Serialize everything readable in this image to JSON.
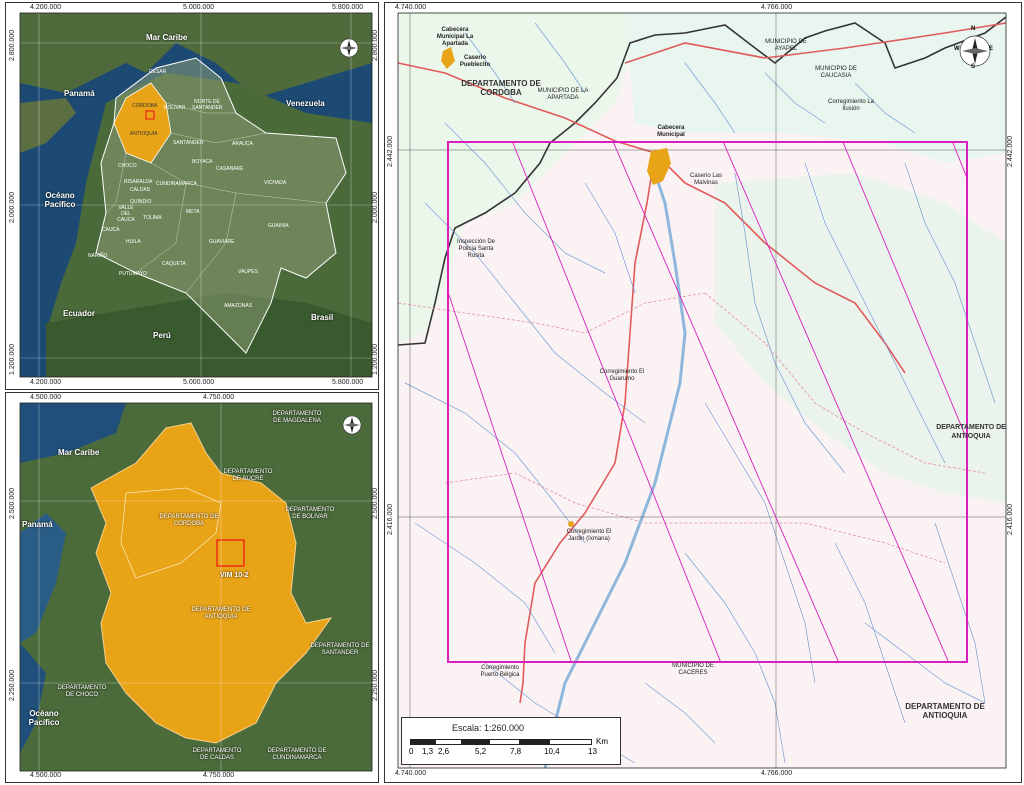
{
  "panel_tl": {
    "coords_top": [
      "4.200.000",
      "5.000.000",
      "5.800.000"
    ],
    "coords_bottom": [
      "4.200.000",
      "5.000.000",
      "5.800.000"
    ],
    "coords_left": [
      "2.800.000",
      "2.000.000",
      "1.200.000"
    ],
    "coords_right": [
      "2.800.000",
      "2.000.000",
      "1.200.000"
    ],
    "oceans": [
      "Mar Caribe",
      "Océano Pacífico"
    ],
    "countries": [
      "Panamá",
      "Venezuela",
      "Ecuador",
      "Perú",
      "Brasil"
    ],
    "departments": [
      "CESAR",
      "CORDOBA",
      "BOLIVAR",
      "NORTE DE SANTANDER",
      "ANTIOQUIA",
      "SANTANDER",
      "ARAUCA",
      "CHOCO",
      "BOYACA",
      "CASANARE",
      "RISARALDA",
      "CUNDINAMARCA",
      "VICHADA",
      "CALDAS",
      "QUINDIO",
      "META",
      "VALLE DEL CAUCA",
      "TOLIMA",
      "HUILA",
      "GUAINIA",
      "CAUCA",
      "NARIÑO",
      "GUAVIARE",
      "PUTUMAYO",
      "CAQUETA",
      "VAUPES",
      "AMAZONAS"
    ]
  },
  "panel_bl": {
    "coords_top": [
      "4.500.000",
      "4.750.000"
    ],
    "coords_bottom": [
      "4.500.000",
      "4.750.000"
    ],
    "coords_left": [
      "2.500.000",
      "2.250.000"
    ],
    "coords_right": [
      "2.500.000",
      "2.250.000"
    ],
    "oceans": [
      "Mar Caribe",
      "Océano Pacífico"
    ],
    "countries": [
      "Panamá"
    ],
    "depts": [
      "DEPARTAMENTO DE MAGDALENA",
      "DEPARTAMENTO DE SUCRE",
      "DEPARTAMENTO DE BOLIVAR",
      "DEPARTAMENTO DE CORDOBA",
      "DEPARTAMENTO DE ANTIOQUIA",
      "DEPARTAMENTO DE SANTANDER",
      "DEPARTAMENTO DE CHOCO",
      "DEPARTAMENTO DE CALDAS",
      "DEPARTAMENTO DE CUNDINAMARCA"
    ],
    "block_label": "VIM 10-2"
  },
  "panel_main": {
    "coords_top": [
      "4.740.000",
      "4.766.000"
    ],
    "coords_bottom": [
      "4.740.000",
      "4.766.000"
    ],
    "coords_left": [
      "2.442.000",
      "2.416.000"
    ],
    "coords_right": [
      "2.442.000",
      "2.416.000"
    ],
    "places": {
      "p1": "Cabecera Municipal La Apartada",
      "p2": "Caserio Pueblecito",
      "p3": "DEPARTAMENTO DE CORDOBA",
      "p4": "MUNICIPIO DE LA APARTADA",
      "p5": "MUNICIPIO DE AYAPEL",
      "p6": "MUNICIPIO DE CAUCASIA",
      "p7": "Corregimiento La Ilusión",
      "p8": "Cabecera Municipal",
      "p9": "Caserio Las Malvinas",
      "p10": "Inspección De Policia Santa Rosita",
      "p11": "Corregimiento El Guarumo",
      "p12": "DEPARTAMENTO DE ANTIOQUIA",
      "p13": "Corregimiento El Jardin (Ixmana)",
      "p14": "Corregimiento Puerto Bélgica",
      "p15": "MUNICIPIO DE CACERES",
      "p16": "DEPARTAMENTO DE ANTIOQUIA"
    },
    "scale_title": "Escala: 1:260.000",
    "scale_ticks": [
      "0",
      "1,3",
      "2,6",
      "5,2",
      "7,8",
      "10,4",
      "13"
    ],
    "scale_unit": "Km"
  },
  "compass_letters": [
    "N",
    "W",
    "E",
    "S"
  ]
}
